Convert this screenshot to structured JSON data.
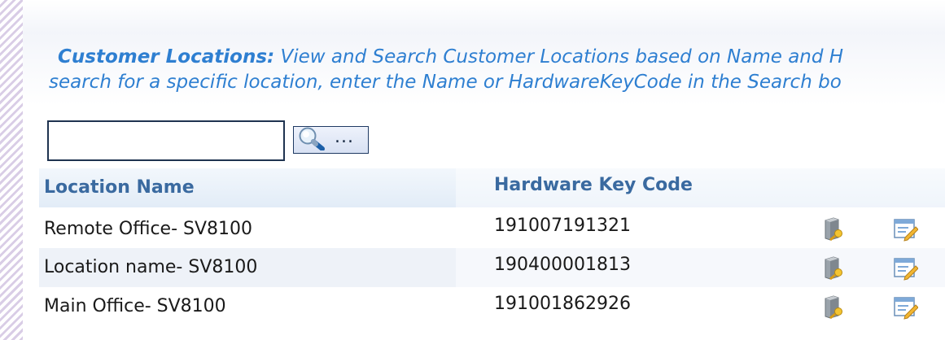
{
  "intro": {
    "lead_label": "Customer Locations:",
    "line1_text": "View and Search Customer Locations based on Name and H",
    "line2_text": "search for a specific location, enter the Name or HardwareKeyCode in the Search bo"
  },
  "search": {
    "value": "",
    "placeholder": "",
    "button_label": "..."
  },
  "table": {
    "columns": [
      "Location Name",
      "Hardware Key Code"
    ],
    "rows": [
      {
        "name": "Remote Office- SV8100",
        "key": "191007191321"
      },
      {
        "name": "Location name- SV8100",
        "key": "190400001813"
      },
      {
        "name": "Main Office- SV8100",
        "key": "191001862926"
      }
    ]
  },
  "icons": {
    "row_action_1": "server-key-icon",
    "row_action_2": "edit-form-icon"
  },
  "colors": {
    "accent_text": "#2e7fd1",
    "header_text": "#3a6aa0"
  }
}
